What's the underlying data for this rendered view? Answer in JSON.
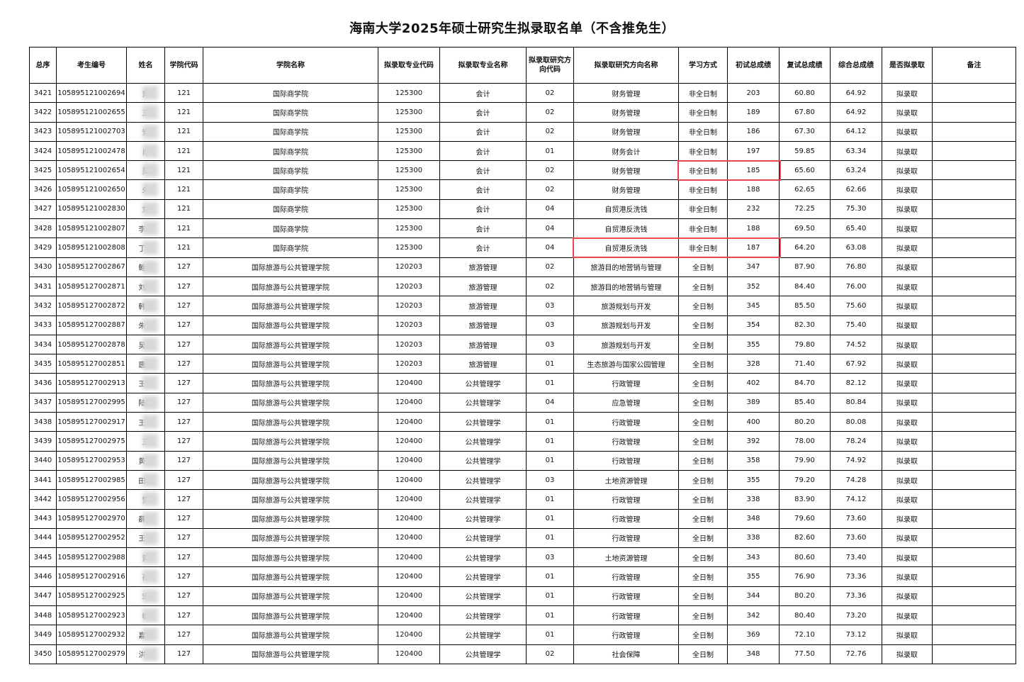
{
  "title": "海南大学2025年硕士研究生拟录取名单（不含推免生）",
  "headers": [
    "总序",
    "考生编号",
    "姓名",
    "学院代码",
    "学院名称",
    "拟录取专业代码",
    "拟录取专业名称",
    "拟录取研究方向代码",
    "拟录取研究方向名称",
    "学习方式",
    "初试总成绩",
    "复试总成绩",
    "综合总成绩",
    "是否拟录取",
    "备注"
  ],
  "highlight_color": "#e8454d",
  "rows": [
    [
      "3421",
      "105895121002694",
      "黄",
      "121",
      "国际商学院",
      "125300",
      "会计",
      "02",
      "财务管理",
      "非全日制",
      "203",
      "60.80",
      "64.92",
      "拟录取",
      ""
    ],
    [
      "3422",
      "105895121002655",
      "王",
      "121",
      "国际商学院",
      "125300",
      "会计",
      "02",
      "财务管理",
      "非全日制",
      "189",
      "67.80",
      "64.92",
      "拟录取",
      ""
    ],
    [
      "3423",
      "105895121002703",
      "安",
      "121",
      "国际商学院",
      "125300",
      "会计",
      "02",
      "财务管理",
      "非全日制",
      "186",
      "67.30",
      "64.12",
      "拟录取",
      ""
    ],
    [
      "3424",
      "105895121002478",
      "肖",
      "121",
      "国际商学院",
      "125300",
      "会计",
      "01",
      "财务会计",
      "非全日制",
      "197",
      "59.85",
      "63.34",
      "拟录取",
      ""
    ],
    [
      "3425",
      "105895121002654",
      "吴",
      "121",
      "国际商学院",
      "125300",
      "会计",
      "02",
      "财务管理",
      "非全日制",
      "185",
      "65.60",
      "63.24",
      "拟录取",
      ""
    ],
    [
      "3426",
      "105895121002650",
      "朱",
      "121",
      "国际商学院",
      "125300",
      "会计",
      "02",
      "财务管理",
      "非全日制",
      "188",
      "62.65",
      "62.66",
      "拟录取",
      ""
    ],
    [
      "3427",
      "105895121002830",
      "刘",
      "121",
      "国际商学院",
      "125300",
      "会计",
      "04",
      "自贸港反洗钱",
      "非全日制",
      "232",
      "72.25",
      "75.30",
      "拟录取",
      ""
    ],
    [
      "3428",
      "105895121002807",
      "李东",
      "121",
      "国际商学院",
      "125300",
      "会计",
      "04",
      "自贸港反洗钱",
      "非全日制",
      "188",
      "69.50",
      "65.40",
      "拟录取",
      ""
    ],
    [
      "3429",
      "105895121002808",
      "丁伟",
      "121",
      "国际商学院",
      "125300",
      "会计",
      "04",
      "自贸港反洗钱",
      "非全日制",
      "187",
      "64.20",
      "63.08",
      "拟录取",
      ""
    ],
    [
      "3430",
      "105895127002867",
      "鲍厚",
      "127",
      "国际旅游与公共管理学院",
      "120203",
      "旅游管理",
      "02",
      "旅游目的地营销与管理",
      "全日制",
      "347",
      "87.90",
      "76.80",
      "拟录取",
      ""
    ],
    [
      "3431",
      "105895127002871",
      "刘双",
      "127",
      "国际旅游与公共管理学院",
      "120203",
      "旅游管理",
      "02",
      "旅游目的地营销与管理",
      "全日制",
      "352",
      "84.40",
      "76.00",
      "拟录取",
      ""
    ],
    [
      "3432",
      "105895127002872",
      "韩如",
      "127",
      "国际旅游与公共管理学院",
      "120203",
      "旅游管理",
      "03",
      "旅游规划与开发",
      "全日制",
      "345",
      "85.50",
      "75.60",
      "拟录取",
      ""
    ],
    [
      "3433",
      "105895127002887",
      "朱俊",
      "127",
      "国际旅游与公共管理学院",
      "120203",
      "旅游管理",
      "03",
      "旅游规划与开发",
      "全日制",
      "354",
      "82.30",
      "75.40",
      "拟录取",
      ""
    ],
    [
      "3434",
      "105895127002878",
      "吴义",
      "127",
      "国际旅游与公共管理学院",
      "120203",
      "旅游管理",
      "03",
      "旅游规划与开发",
      "全日制",
      "355",
      "79.80",
      "74.52",
      "拟录取",
      ""
    ],
    [
      "3435",
      "105895127002851",
      "唐乾",
      "127",
      "国际旅游与公共管理学院",
      "120203",
      "旅游管理",
      "01",
      "生态旅游与国家公园管理",
      "全日制",
      "328",
      "71.40",
      "67.92",
      "拟录取",
      ""
    ],
    [
      "3436",
      "105895127002913",
      "王元",
      "127",
      "国际旅游与公共管理学院",
      "120400",
      "公共管理学",
      "01",
      "行政管理",
      "全日制",
      "402",
      "84.70",
      "82.12",
      "拟录取",
      ""
    ],
    [
      "3437",
      "105895127002995",
      "陆枫",
      "127",
      "国际旅游与公共管理学院",
      "120400",
      "公共管理学",
      "04",
      "应急管理",
      "全日制",
      "389",
      "85.40",
      "80.84",
      "拟录取",
      ""
    ],
    [
      "3438",
      "105895127002917",
      "王芊",
      "127",
      "国际旅游与公共管理学院",
      "120400",
      "公共管理学",
      "01",
      "行政管理",
      "全日制",
      "400",
      "80.20",
      "80.08",
      "拟录取",
      ""
    ],
    [
      "3439",
      "105895127002975",
      "王",
      "127",
      "国际旅游与公共管理学院",
      "120400",
      "公共管理学",
      "01",
      "行政管理",
      "全日制",
      "392",
      "78.00",
      "78.24",
      "拟录取",
      ""
    ],
    [
      "3440",
      "105895127002953",
      "黄卫",
      "127",
      "国际旅游与公共管理学院",
      "120400",
      "公共管理学",
      "01",
      "行政管理",
      "全日制",
      "358",
      "79.90",
      "74.92",
      "拟录取",
      ""
    ],
    [
      "3441",
      "105895127002985",
      "田瑞",
      "127",
      "国际旅游与公共管理学院",
      "120400",
      "公共管理学",
      "03",
      "土地资源管理",
      "全日制",
      "355",
      "79.20",
      "74.28",
      "拟录取",
      ""
    ],
    [
      "3442",
      "105895127002956",
      "贺",
      "127",
      "国际旅游与公共管理学院",
      "120400",
      "公共管理学",
      "01",
      "行政管理",
      "全日制",
      "338",
      "83.90",
      "74.12",
      "拟录取",
      ""
    ],
    [
      "3443",
      "105895127002970",
      "薛佳",
      "127",
      "国际旅游与公共管理学院",
      "120400",
      "公共管理学",
      "01",
      "行政管理",
      "全日制",
      "348",
      "79.60",
      "73.60",
      "拟录取",
      ""
    ],
    [
      "3444",
      "105895127002952",
      "王彤",
      "127",
      "国际旅游与公共管理学院",
      "120400",
      "公共管理学",
      "01",
      "行政管理",
      "全日制",
      "338",
      "82.60",
      "73.60",
      "拟录取",
      ""
    ],
    [
      "3445",
      "105895127002988",
      "黄",
      "127",
      "国际旅游与公共管理学院",
      "120400",
      "公共管理学",
      "03",
      "土地资源管理",
      "全日制",
      "343",
      "80.60",
      "73.40",
      "拟录取",
      ""
    ],
    [
      "3446",
      "105895127002916",
      "孙",
      "127",
      "国际旅游与公共管理学院",
      "120400",
      "公共管理学",
      "01",
      "行政管理",
      "全日制",
      "355",
      "76.90",
      "73.36",
      "拟录取",
      ""
    ],
    [
      "3447",
      "105895127002925",
      "宋",
      "127",
      "国际旅游与公共管理学院",
      "120400",
      "公共管理学",
      "01",
      "行政管理",
      "全日制",
      "344",
      "80.20",
      "73.36",
      "拟录取",
      ""
    ],
    [
      "3448",
      "105895127002923",
      "帆",
      "127",
      "国际旅游与公共管理学院",
      "120400",
      "公共管理学",
      "01",
      "行政管理",
      "全日制",
      "342",
      "80.40",
      "73.20",
      "拟录取",
      ""
    ],
    [
      "3449",
      "105895127002932",
      "嘉莹",
      "127",
      "国际旅游与公共管理学院",
      "120400",
      "公共管理学",
      "01",
      "行政管理",
      "全日制",
      "369",
      "72.10",
      "73.12",
      "拟录取",
      ""
    ],
    [
      "3450",
      "105895127002979",
      "洪悦",
      "127",
      "国际旅游与公共管理学院",
      "120400",
      "公共管理学",
      "02",
      "社会保障",
      "全日制",
      "348",
      "77.50",
      "72.76",
      "拟录取",
      ""
    ]
  ]
}
